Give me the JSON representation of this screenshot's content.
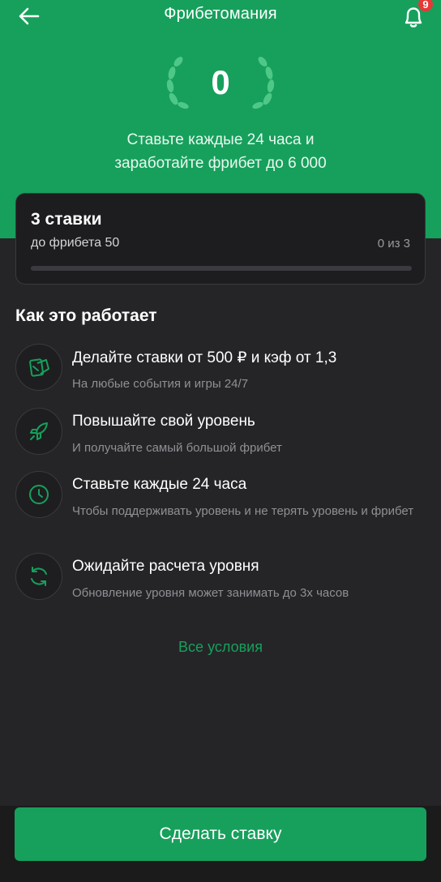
{
  "header": {
    "title": "Фрибетомания",
    "notification_count": "9"
  },
  "hero": {
    "level": "0",
    "description_line1": "Ставьте каждые 24 часа и",
    "description_line2": "заработайте фрибет до 6 000"
  },
  "progress": {
    "title": "3 ставки",
    "subtitle": "до фрибета 50",
    "count": "0 из 3",
    "fraction": 0
  },
  "how_it_works": {
    "title": "Как это работает",
    "steps": [
      {
        "icon": "ticket-icon",
        "title": "Делайте ставки от 500 ₽ и кэф от 1,3",
        "desc": "На любые события и игры 24/7"
      },
      {
        "icon": "rocket-icon",
        "title": "Повышайте свой уровень",
        "desc": "И получайте самый большой фрибет"
      },
      {
        "icon": "clock-icon",
        "title": "Ставьте каждые 24 часа",
        "desc": "Чтобы поддерживать уровень и не терять уровень и фрибет"
      },
      {
        "icon": "refresh-icon",
        "title": "Ожидайте расчета уровня",
        "desc": "Обновление уровня может занимать до 3х часов"
      }
    ],
    "all_conditions": "Все условия"
  },
  "actions": {
    "bet_button": "Сделать ставку"
  },
  "colors": {
    "brand_green": "#16a05c",
    "background": "#252527",
    "badge_red": "#e53935"
  }
}
